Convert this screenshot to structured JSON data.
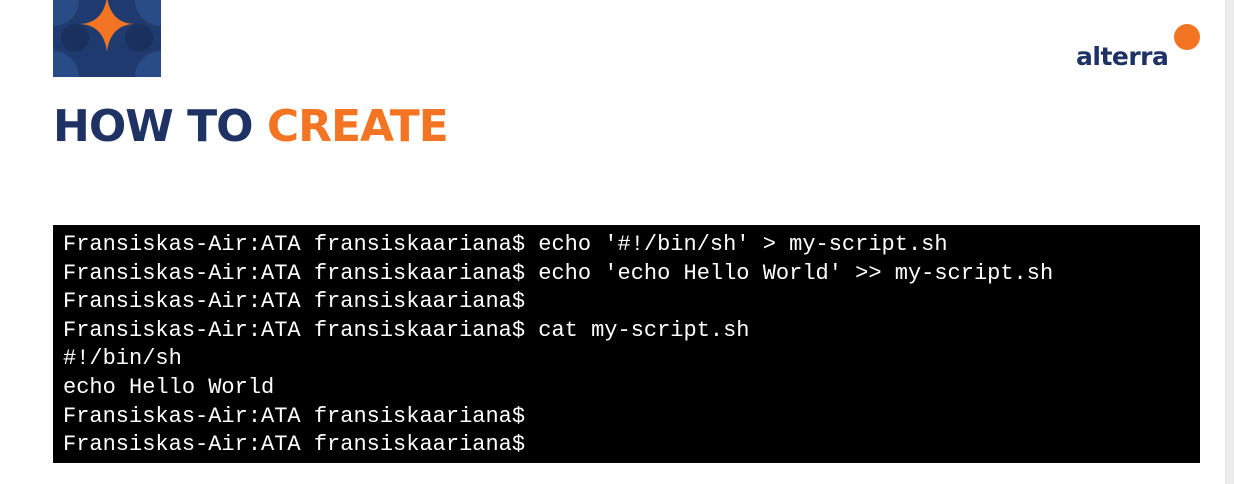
{
  "brand": {
    "name": "alterra",
    "colors": {
      "navy": "#1e3264",
      "orange": "#f37524",
      "terminal_bg": "#000000",
      "terminal_fg": "#ffffff"
    },
    "tile_icon": "four-point-star-tile-icon"
  },
  "heading": {
    "word1": "HOW TO",
    "word2": "CREATE"
  },
  "terminal": {
    "lines": [
      "Fransiskas-Air:ATA fransiskaariana$ echo '#!/bin/sh' > my-script.sh",
      "Fransiskas-Air:ATA fransiskaariana$ echo 'echo Hello World' >> my-script.sh",
      "Fransiskas-Air:ATA fransiskaariana$",
      "Fransiskas-Air:ATA fransiskaariana$ cat my-script.sh",
      "#!/bin/sh",
      "echo Hello World",
      "Fransiskas-Air:ATA fransiskaariana$",
      "Fransiskas-Air:ATA fransiskaariana$"
    ]
  }
}
